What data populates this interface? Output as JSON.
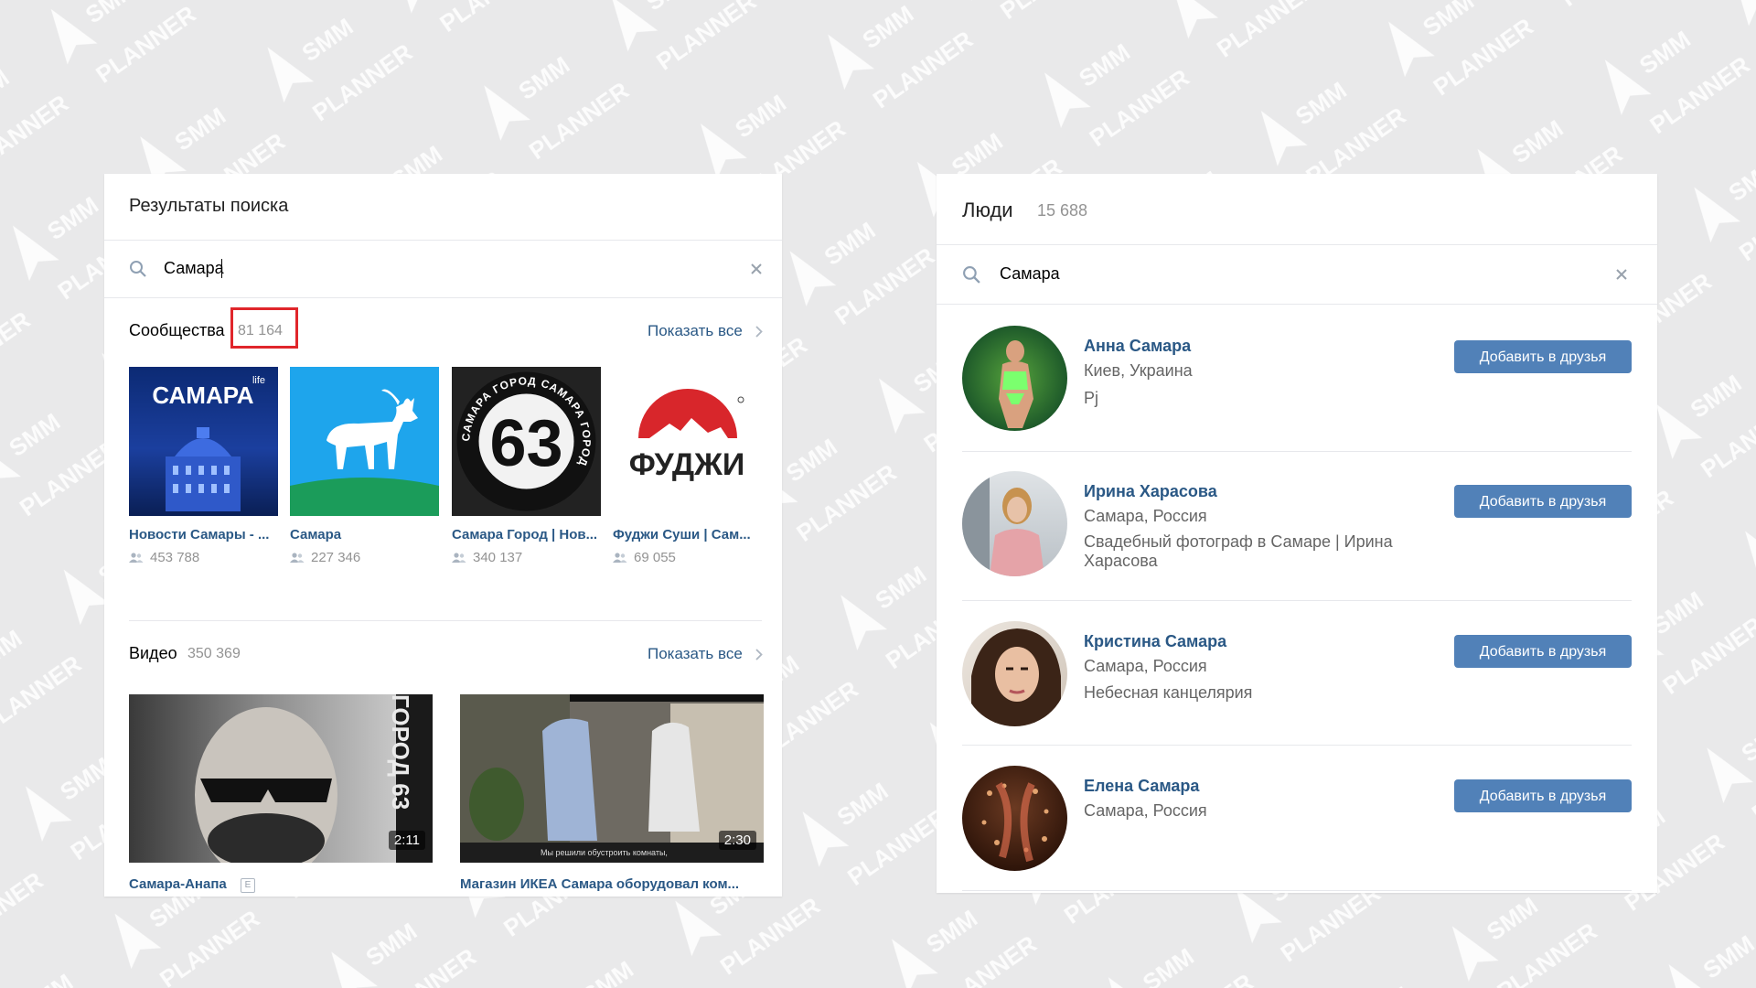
{
  "colors": {
    "link": "#2a5885",
    "button": "#5181b8",
    "highlight": "#e0262b",
    "muted": "#939393"
  },
  "watermark": {
    "text": "SMM PLANNER"
  },
  "left_panel": {
    "title": "Результаты поиска",
    "search": {
      "value": "Самара",
      "icon": "search-icon",
      "clear_icon": "close-icon"
    },
    "communities": {
      "label": "Сообщества",
      "count": "81 164",
      "show_all": "Показать все",
      "items": [
        {
          "name": "Новости Самары - ...",
          "members": "453 788",
          "thumb_text": "САМАРА",
          "thumb_sub": "life"
        },
        {
          "name": "Самара",
          "members": "227 346"
        },
        {
          "name": "Самара Город | Нов...",
          "members": "340 137",
          "thumb_text": "63",
          "ring_text": "САМАРА ГОРОД САМАРА ГОРОД"
        },
        {
          "name": "Фуджи Суши | Сам...",
          "members": "69 055",
          "thumb_text": "ФУДЖИ"
        }
      ]
    },
    "videos": {
      "label": "Видео",
      "count": "350 369",
      "show_all": "Показать все",
      "items": [
        {
          "title": "Самара-Анапа",
          "duration": "2:11",
          "badge": "E",
          "overlay_text": "ГОРОД 63"
        },
        {
          "title": "Магазин ИКЕА Самара оборудовал ком...",
          "duration": "2:30",
          "subtitle": "Мы решили обустроить комнаты,"
        }
      ]
    }
  },
  "right_panel": {
    "title": "Люди",
    "count": "15 688",
    "search": {
      "value": "Самара",
      "icon": "search-icon",
      "clear_icon": "close-icon"
    },
    "people": [
      {
        "name": "Анна Самара",
        "location": "Киев, Украина",
        "desc": "Pj",
        "button": "Добавить в друзья"
      },
      {
        "name": "Ирина Харасова",
        "location": "Самара, Россия",
        "desc": "Свадебный фотограф в Самаре | Ирина Харасова",
        "button": "Добавить в друзья"
      },
      {
        "name": "Кристина Самара",
        "location": "Самара, Россия",
        "desc": "Небесная канцелярия",
        "button": "Добавить в друзья"
      },
      {
        "name": "Елена Самара",
        "location": "Самара, Россия",
        "desc": "",
        "button": "Добавить в друзья"
      }
    ]
  }
}
